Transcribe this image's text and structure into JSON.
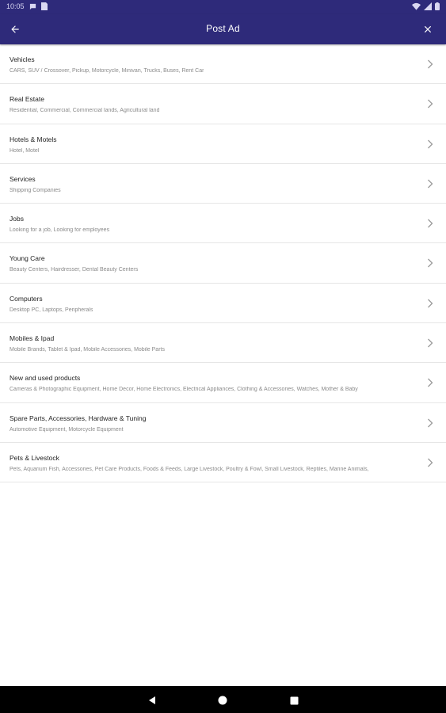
{
  "status_bar": {
    "time": "10:05",
    "icons": [
      "message-icon",
      "sim-icon",
      "wifi-icon",
      "signal-icon",
      "battery-icon"
    ]
  },
  "app_bar": {
    "title": "Post Ad",
    "back_icon": "arrow-left-icon",
    "close_icon": "close-icon",
    "background": "#2e2a7a"
  },
  "categories": [
    {
      "title": "Vehicles",
      "subtitle": "CARS, SUV / Crossover, Pickup, Motorcycle, Minivan, Trucks, Buses, Rent Car"
    },
    {
      "title": "Real Estate",
      "subtitle": "Residential, Commercial, Commercial lands, Agricultural land"
    },
    {
      "title": "Hotels & Motels",
      "subtitle": "Hotel, Motel"
    },
    {
      "title": "Services",
      "subtitle": "Shipping Companies"
    },
    {
      "title": "Jobs",
      "subtitle": "Looking for a job, Looking for employees"
    },
    {
      "title": "Young Care",
      "subtitle": "Beauty Centers, Hairdresser, Dental Beauty Centers"
    },
    {
      "title": "Computers",
      "subtitle": "Desktop PC, Laptops, Peripherals"
    },
    {
      "title": "Mobiles & Ipad",
      "subtitle": "Mobile Brands, Tablet & Ipad, Mobile Accessories, Mobile Parts"
    },
    {
      "title": "New and used products",
      "subtitle": "Cameras & Photographic Equipment, Home Decor, Home Electronics, Electrical Appliances, Clothing & Accessories, Watches, Mother & Baby"
    },
    {
      "title": "Spare Parts, Accessories, Hardware & Tuning",
      "subtitle": "Automotive Equipment, Motorcycle Equipment"
    },
    {
      "title": "Pets & Livestock",
      "subtitle": "Pets, Aquarium Fish, Accessories, Pet Care Products, Foods & Feeds, Large Livestock, Poultry & Fowl, Small Livestock, Reptiles, Marine Animals,"
    }
  ],
  "nav_bar": {
    "buttons": [
      "back-triangle-icon",
      "home-circle-icon",
      "recents-square-icon"
    ]
  }
}
